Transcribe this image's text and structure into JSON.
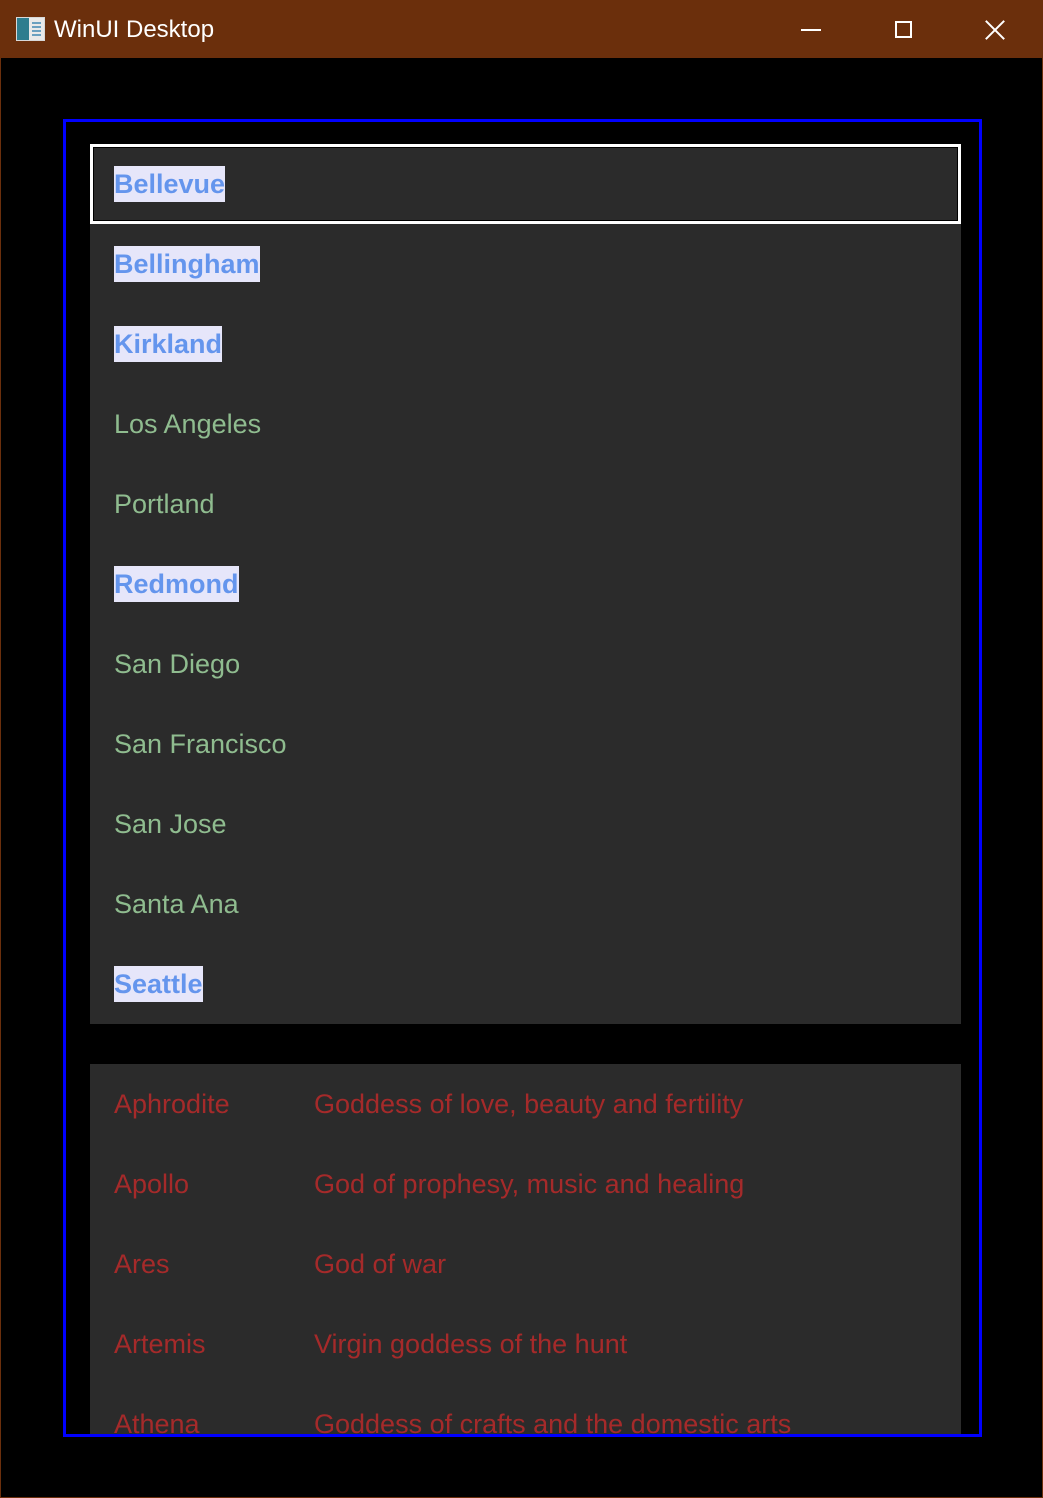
{
  "window": {
    "title": "WinUI Desktop",
    "titlebar_color": "#6b2f0c",
    "controls": [
      "minimize-icon",
      "maximize-icon",
      "close-icon"
    ]
  },
  "colors": {
    "frame_border": "#0000ff",
    "list_background": "#2b2b2b",
    "city_text": "#8fbc8f",
    "highlight_background": "#e6e6fa",
    "highlight_text": "#6495ed",
    "god_text": "#a52a2a"
  },
  "cities": [
    {
      "label": "Bellevue",
      "highlighted": true,
      "focused": true
    },
    {
      "label": "Bellingham",
      "highlighted": true,
      "focused": false
    },
    {
      "label": "Kirkland",
      "highlighted": true,
      "focused": false
    },
    {
      "label": "Los Angeles",
      "highlighted": false,
      "focused": false
    },
    {
      "label": "Portland",
      "highlighted": false,
      "focused": false
    },
    {
      "label": "Redmond",
      "highlighted": true,
      "focused": false
    },
    {
      "label": "San Diego",
      "highlighted": false,
      "focused": false
    },
    {
      "label": "San Francisco",
      "highlighted": false,
      "focused": false
    },
    {
      "label": "San Jose",
      "highlighted": false,
      "focused": false
    },
    {
      "label": "Santa Ana",
      "highlighted": false,
      "focused": false
    },
    {
      "label": "Seattle",
      "highlighted": true,
      "focused": false
    }
  ],
  "gods": [
    {
      "name": "Aphrodite",
      "description": "Goddess of love, beauty and fertility"
    },
    {
      "name": "Apollo",
      "description": "God of prophesy, music and healing"
    },
    {
      "name": "Ares",
      "description": "God of war"
    },
    {
      "name": "Artemis",
      "description": "Virgin goddess of the hunt"
    },
    {
      "name": "Athena",
      "description": "Goddess of crafts and the domestic arts"
    }
  ]
}
